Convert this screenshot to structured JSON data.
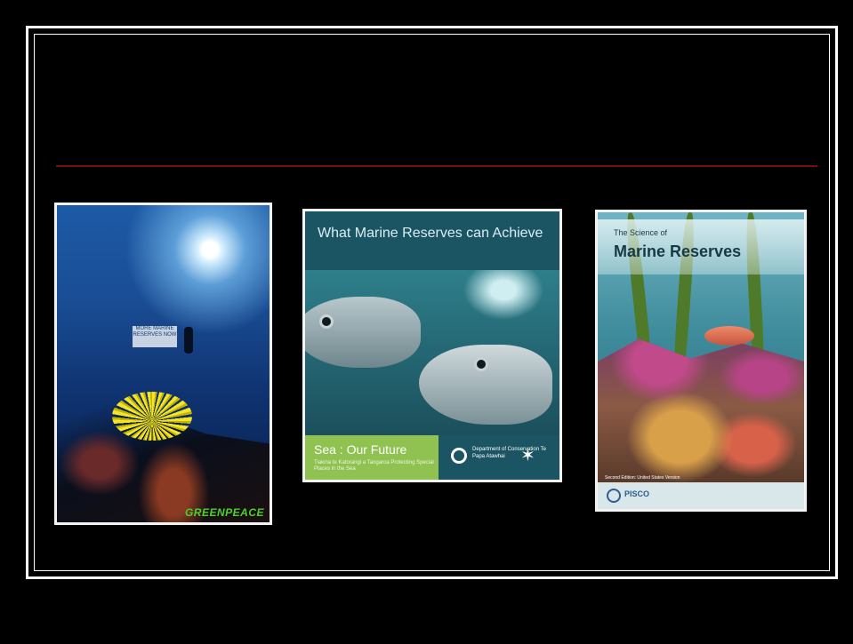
{
  "slide": {
    "colors": {
      "background": "#000000",
      "frame": "#ffffff",
      "divider": "#7a0d0d"
    }
  },
  "cards": [
    {
      "id": "greenpeace",
      "banner_text": "MORE MARINE RESERVES NOW",
      "logo_text": "GREENPEACE"
    },
    {
      "id": "what-marine-reserves",
      "title": "What Marine Reserves can Achieve",
      "subtitle": "Sea : Our Future",
      "tagline": "Tiakina te Katorangi a Tangaroa Protecting Special Places in the Sea",
      "org_text": "Department of Conservation Te Papa Atawhai"
    },
    {
      "id": "science-of-marine-reserves",
      "title_small": "The Science of",
      "title_big": "Marine Reserves",
      "edition_text": "Second Edition: United States Version",
      "org_text": "PISCO"
    }
  ]
}
